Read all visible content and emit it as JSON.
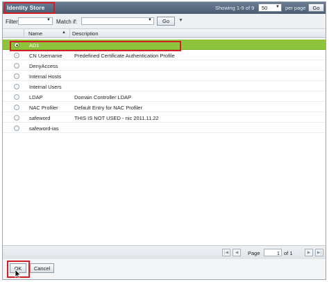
{
  "header": {
    "title": "Identity Store",
    "showing": "Showing 1-9 of 9",
    "per_page_value": "50",
    "per_page_label": "per page",
    "go_label": "Go"
  },
  "filter": {
    "filter_label": "Filter:",
    "match_label": "Match if:",
    "go_label": "Go"
  },
  "table": {
    "columns": [
      "Name",
      "Description"
    ],
    "selected_index": 0,
    "rows": [
      {
        "name": "AD1",
        "description": ""
      },
      {
        "name": "CN Username",
        "description": "Predefined Certificate Authentication Profile"
      },
      {
        "name": "DenyAccess",
        "description": ""
      },
      {
        "name": "Internal Hosts",
        "description": ""
      },
      {
        "name": "Internal Users",
        "description": ""
      },
      {
        "name": "LDAP",
        "description": "Domain Controller LDAP"
      },
      {
        "name": "NAC Profiler",
        "description": "Default Entry for NAC Profiler"
      },
      {
        "name": "safeword",
        "description": "THIS IS NOT USED - nic 2011.11.22"
      },
      {
        "name": "safeword-ias",
        "description": ""
      }
    ]
  },
  "pager": {
    "page_label": "Page",
    "page_value": "1",
    "of_label": "of 1"
  },
  "footer": {
    "ok_label": "OK",
    "cancel_label": "Cancel"
  },
  "colors": {
    "selected_row": "#8ec43c",
    "highlight_box": "#d21d26",
    "header_bar": "#56687d"
  }
}
